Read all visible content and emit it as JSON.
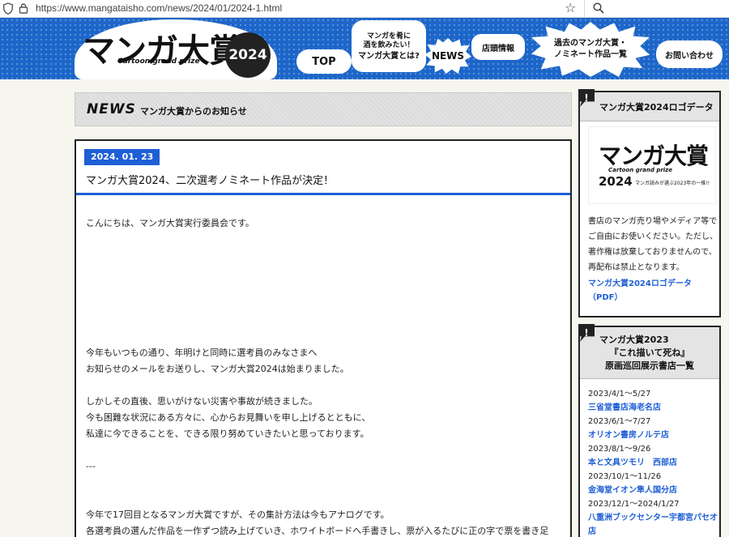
{
  "browser": {
    "url": "https://www.mangataisho.com/news/2024/01/2024-1.html"
  },
  "header": {
    "logo_text": "マンガ大賞",
    "logo_sub": "Cartoon grand prize",
    "logo_year": "2024",
    "nav": {
      "top": "TOP",
      "about_small_1": "マンガを肴に",
      "about_small_2": "酒を飲みたい！",
      "about_big": "マンガ大賞とは?",
      "news": "NEWS",
      "store": "店頭情報",
      "past_1": "過去のマンガ大賞・",
      "past_2": "ノミネート作品一覧",
      "contact": "お問い合わせ"
    }
  },
  "section": {
    "word": "NEWS",
    "subtitle": "マンガ大賞からのお知らせ"
  },
  "article": {
    "date": "2024. 01. 23",
    "title": "マンガ大賞2024、二次選考ノミネート作品が決定！",
    "greeting": "こんにちは、マンガ大賞実行委員会です。",
    "p1_l1": "今年もいつもの通り、年明けと同時に選考員のみなさまへ",
    "p1_l2": "お知らせのメールをお送りし、マンガ大賞2024は始まりました。",
    "p2_l1": "しかしその直後、思いがけない災害や事故が続きました。",
    "p2_l2": "今も困難な状況にある方々に、心からお見舞いを申し上げるとともに、",
    "p2_l3": "私達に今できることを、できる限り努めていきたいと思っております。",
    "sep": "---",
    "p3_l1": "今年で17回目となるマンガ大賞ですが、その集計方法は今もアナログです。",
    "p3_l2": "各選考員の選んだ作品を一作ずつ読み上げていき、ホワイトボードへ手書きし、票が入るたびに正の字で票を書き足"
  },
  "sidebar": {
    "logo_box": {
      "heading": "マンガ大賞2024ロゴデータ",
      "logo_text": "マンガ大賞",
      "logo_sub": "Cartoon grand prize",
      "logo_year": "2024",
      "logo_caption": "マンガ読みが選ぶ2023年の一推!!",
      "desc_1": "書店のマンガ売り場やメディア等で",
      "desc_2": "ご自由にお使いください。ただし、",
      "desc_3": "著作権は放棄しておりませんので、",
      "desc_4": "再配布は禁止となります。",
      "link_1": "マンガ大賞2024ロゴデータ",
      "link_2": "（PDF）"
    },
    "exhibit_box": {
      "heading_1": "マンガ大賞2023",
      "heading_2": "『これ描いて死ね』",
      "heading_3": "原画巡回展示書店一覧",
      "items": [
        {
          "date": "2023/4/1～5/27",
          "store": "三省堂書店海老名店"
        },
        {
          "date": "2023/6/1～7/27",
          "store": "オリオン書房ノルテ店"
        },
        {
          "date": "2023/8/1～9/26",
          "store": "本と文具ツモリ　西部店"
        },
        {
          "date": "2023/10/1～11/26",
          "store": "金海堂イオン隼人国分店"
        },
        {
          "date": "2023/12/1～2024/1/27",
          "store": "八重洲ブックセンター宇都宮パセオ店"
        }
      ]
    }
  }
}
